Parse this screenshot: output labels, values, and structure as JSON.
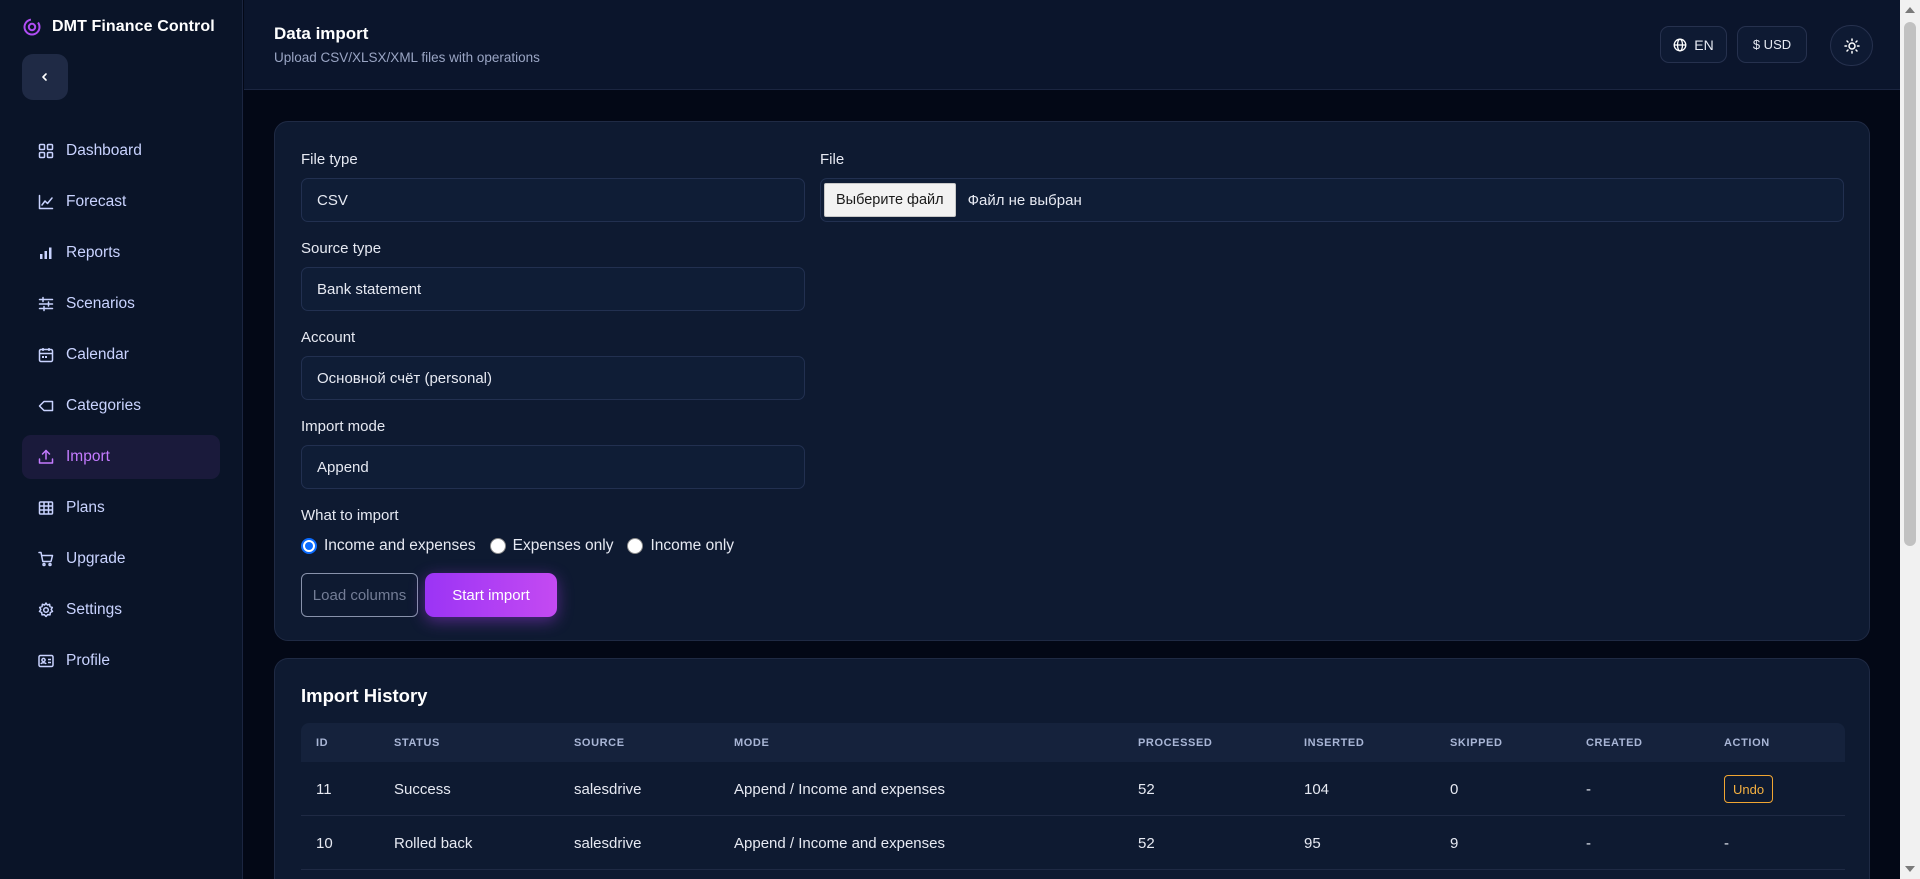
{
  "app": {
    "name": "DMT Finance Control"
  },
  "sidebar": {
    "collapse_icon": "chevron-left-icon",
    "items": [
      {
        "label": "Dashboard",
        "icon": "grid-icon",
        "active": false
      },
      {
        "label": "Forecast",
        "icon": "line-chart-icon",
        "active": false
      },
      {
        "label": "Reports",
        "icon": "bar-chart-icon",
        "active": false
      },
      {
        "label": "Scenarios",
        "icon": "sliders-icon",
        "active": false
      },
      {
        "label": "Calendar",
        "icon": "calendar-icon",
        "active": false
      },
      {
        "label": "Categories",
        "icon": "tag-icon",
        "active": false
      },
      {
        "label": "Import",
        "icon": "upload-icon",
        "active": true
      },
      {
        "label": "Plans",
        "icon": "table-icon",
        "active": false
      },
      {
        "label": "Upgrade",
        "icon": "cart-icon",
        "active": false
      },
      {
        "label": "Settings",
        "icon": "gear-icon",
        "active": false
      },
      {
        "label": "Profile",
        "icon": "id-card-icon",
        "active": false
      }
    ]
  },
  "header": {
    "title": "Data import",
    "subtitle": "Upload CSV/XLSX/XML files with operations",
    "language": "EN",
    "currency": "$ USD"
  },
  "form": {
    "file_type": {
      "label": "File type",
      "value": "CSV"
    },
    "file": {
      "label": "File",
      "button": "Выберите файл",
      "status": "Файл не выбран"
    },
    "source_type": {
      "label": "Source type",
      "value": "Bank statement"
    },
    "account": {
      "label": "Account",
      "value": "Основной счёт (personal)"
    },
    "import_mode": {
      "label": "Import mode",
      "value": "Append"
    },
    "what_to_import": {
      "label": "What to import",
      "options": [
        {
          "label": "Income and expenses",
          "checked": true
        },
        {
          "label": "Expenses only",
          "checked": false
        },
        {
          "label": "Income only",
          "checked": false
        }
      ]
    },
    "load_columns_label": "Load columns",
    "start_import_label": "Start import"
  },
  "history": {
    "title": "Import History",
    "columns": [
      "ID",
      "STATUS",
      "SOURCE",
      "MODE",
      "PROCESSED",
      "INSERTED",
      "SKIPPED",
      "CREATED",
      "ACTION"
    ],
    "rows": [
      {
        "id": "11",
        "status": "Success",
        "source": "salesdrive",
        "mode": "Append / Income and expenses",
        "processed": "52",
        "inserted": "104",
        "skipped": "0",
        "created": "-",
        "action": "Undo"
      },
      {
        "id": "10",
        "status": "Rolled back",
        "source": "salesdrive",
        "mode": "Append / Income and expenses",
        "processed": "52",
        "inserted": "95",
        "skipped": "9",
        "created": "-",
        "action": "-"
      }
    ]
  },
  "colors": {
    "accent": "#b04df4",
    "active_nav_text": "#c47bff",
    "undo": "#f5b041",
    "background": "#030816",
    "sidebar": "#0a1428"
  }
}
